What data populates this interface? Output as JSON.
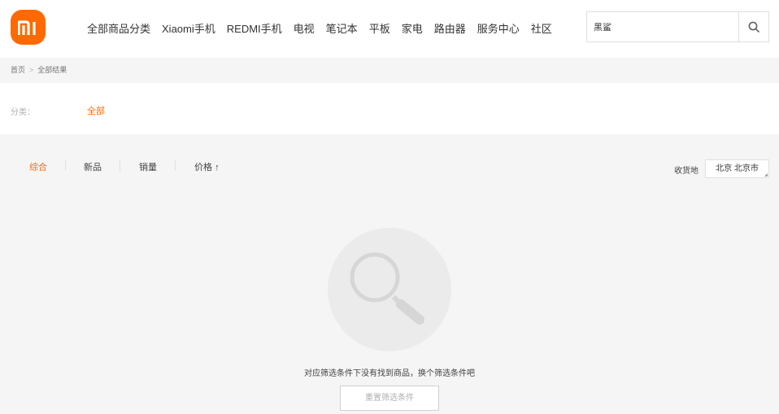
{
  "brand": {
    "logo_text": "mi",
    "color": "#ff6900"
  },
  "nav": {
    "items": [
      "全部商品分类",
      "Xiaomi手机",
      "REDMI手机",
      "电视",
      "笔记本",
      "平板",
      "家电",
      "路由器",
      "服务中心",
      "社区"
    ]
  },
  "search": {
    "value": "黑鲨",
    "icon": "search-icon"
  },
  "breadcrumb": {
    "home": "首页",
    "separator": ">",
    "current": "全部结果"
  },
  "category": {
    "label": "分类：",
    "value": "全部"
  },
  "sort": {
    "items": [
      "综合",
      "新品",
      "销量",
      "价格"
    ],
    "price_arrow": "↑",
    "active": "综合"
  },
  "shipping": {
    "label": "收货地",
    "location": "北京 北京市"
  },
  "empty": {
    "message": "对应筛选条件下没有找到商品，换个筛选条件吧",
    "reset_button": "重置筛选条件",
    "icon": "magnifier-icon"
  },
  "colors": {
    "accent": "#ff6900",
    "background": "#f5f5f5"
  }
}
